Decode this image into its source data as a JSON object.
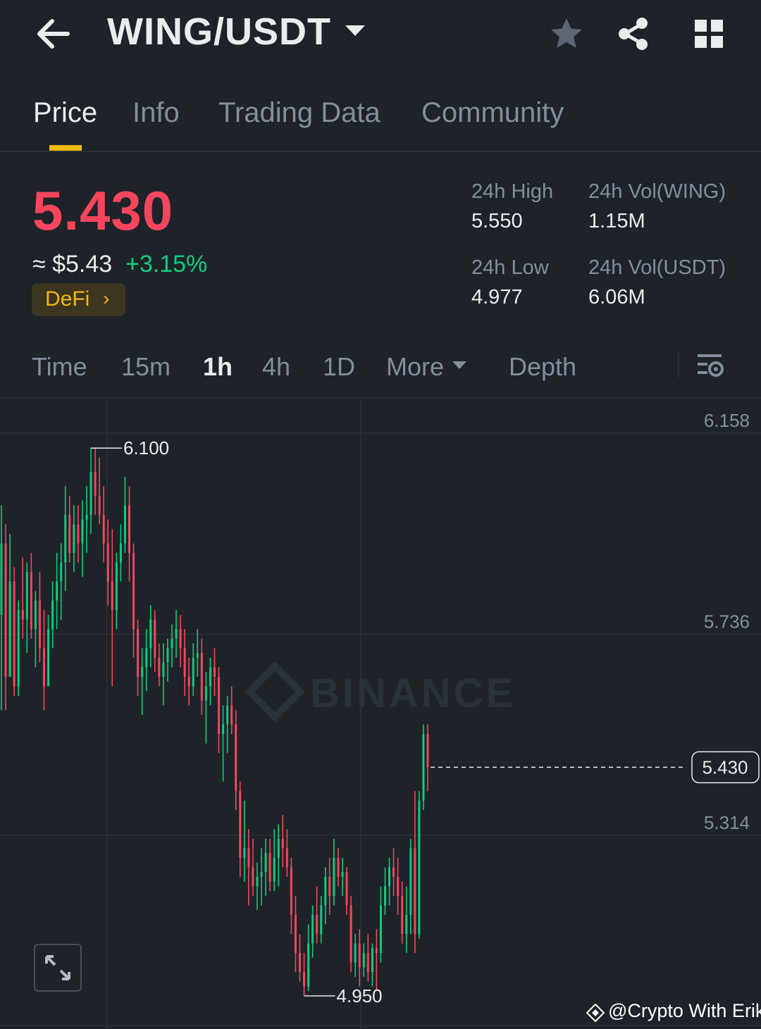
{
  "header": {
    "title": "WING/USDT",
    "back_icon": "arrow-left-icon",
    "dropdown_icon": "caret-down-icon",
    "actions": [
      "star-icon",
      "share-icon",
      "grid-icon"
    ]
  },
  "tabs": [
    {
      "label": "Price",
      "active": true
    },
    {
      "label": "Info",
      "active": false
    },
    {
      "label": "Trading Data",
      "active": false
    },
    {
      "label": "Community",
      "active": false
    }
  ],
  "ticker": {
    "last_price": "5.430",
    "usd_price": "≈ $5.43",
    "change_pct": "+3.15%",
    "tag": "DeFi",
    "tag_chevron": "›",
    "stats": {
      "high_label": "24h High",
      "high_value": "5.550",
      "low_label": "24h Low",
      "low_value": "4.977",
      "vol_base_label": "24h Vol(WING)",
      "vol_base_value": "1.15M",
      "vol_quote_label": "24h Vol(USDT)",
      "vol_quote_value": "6.06M"
    }
  },
  "intervals": {
    "items": [
      "Time",
      "15m",
      "1h",
      "4h",
      "1D"
    ],
    "active": "1h",
    "more": "More",
    "depth": "Depth",
    "settings_icon": "chart-settings-icon"
  },
  "chart_data": {
    "type": "candlestick",
    "interval": "1h",
    "y_axis_labels": [
      "6.158",
      "5.736",
      "5.314"
    ],
    "ylim": [
      4.95,
      6.158
    ],
    "max_marker": "6.100",
    "min_marker": "4.950",
    "last_price_label": "5.430",
    "last_price": 5.43,
    "watermark": "BINANCE",
    "colors": {
      "up": "#0ecb81",
      "down": "#f6465d",
      "grid": "#2b3139",
      "axis_text": "#848e9c"
    },
    "candles": [
      [
        5.75,
        5.98,
        5.55,
        5.9
      ],
      [
        5.9,
        5.94,
        5.55,
        5.62
      ],
      [
        5.62,
        5.92,
        5.65,
        5.82
      ],
      [
        5.82,
        5.85,
        5.58,
        5.6
      ],
      [
        5.6,
        5.78,
        5.58,
        5.76
      ],
      [
        5.76,
        5.87,
        5.7,
        5.74
      ],
      [
        5.74,
        5.86,
        5.67,
        5.84
      ],
      [
        5.84,
        5.88,
        5.7,
        5.72
      ],
      [
        5.72,
        5.8,
        5.64,
        5.78
      ],
      [
        5.78,
        5.84,
        5.65,
        5.68
      ],
      [
        5.68,
        5.76,
        5.55,
        5.6
      ],
      [
        5.6,
        5.75,
        5.66,
        5.72
      ],
      [
        5.72,
        5.82,
        5.68,
        5.78
      ],
      [
        5.78,
        5.88,
        5.72,
        5.82
      ],
      [
        5.82,
        5.9,
        5.74,
        5.86
      ],
      [
        5.86,
        6.02,
        5.8,
        5.96
      ],
      [
        5.96,
        6.0,
        5.86,
        5.88
      ],
      [
        5.88,
        5.98,
        5.84,
        5.94
      ],
      [
        5.94,
        5.98,
        5.86,
        5.9
      ],
      [
        5.9,
        5.99,
        5.83,
        5.95
      ],
      [
        5.95,
        6.02,
        5.88,
        5.96
      ],
      [
        5.96,
        6.1,
        5.92,
        6.05
      ],
      [
        6.05,
        6.1,
        5.96,
        6.0
      ],
      [
        6.0,
        6.08,
        5.94,
        5.96
      ],
      [
        5.96,
        6.02,
        5.86,
        5.9
      ],
      [
        5.9,
        5.95,
        5.77,
        5.82
      ],
      [
        5.82,
        5.93,
        5.6,
        5.76
      ],
      [
        5.76,
        5.88,
        5.72,
        5.86
      ],
      [
        5.86,
        5.94,
        5.82,
        5.9
      ],
      [
        5.9,
        6.04,
        5.88,
        5.98
      ],
      [
        5.98,
        6.02,
        5.82,
        5.88
      ],
      [
        5.88,
        5.9,
        5.66,
        5.72
      ],
      [
        5.72,
        5.74,
        5.58,
        5.62
      ],
      [
        5.62,
        5.68,
        5.54,
        5.64
      ],
      [
        5.64,
        5.72,
        5.59,
        5.68
      ],
      [
        5.68,
        5.77,
        5.64,
        5.74
      ],
      [
        5.74,
        5.76,
        5.63,
        5.66
      ],
      [
        5.66,
        5.69,
        5.6,
        5.62
      ],
      [
        5.62,
        5.69,
        5.56,
        5.65
      ],
      [
        5.65,
        5.7,
        5.61,
        5.68
      ],
      [
        5.68,
        5.73,
        5.64,
        5.7
      ],
      [
        5.7,
        5.76,
        5.66,
        5.72
      ],
      [
        5.72,
        5.75,
        5.64,
        5.68
      ],
      [
        5.68,
        5.72,
        5.58,
        5.62
      ],
      [
        5.62,
        5.66,
        5.56,
        5.6
      ],
      [
        5.6,
        5.69,
        5.58,
        5.66
      ],
      [
        5.66,
        5.72,
        5.62,
        5.67
      ],
      [
        5.67,
        5.7,
        5.54,
        5.57
      ],
      [
        5.57,
        5.63,
        5.48,
        5.6
      ],
      [
        5.6,
        5.66,
        5.56,
        5.64
      ],
      [
        5.64,
        5.68,
        5.58,
        5.62
      ],
      [
        5.62,
        5.64,
        5.46,
        5.5
      ],
      [
        5.5,
        5.56,
        5.4,
        5.52
      ],
      [
        5.52,
        5.58,
        5.46,
        5.56
      ],
      [
        5.56,
        5.6,
        5.5,
        5.52
      ],
      [
        5.52,
        5.55,
        5.34,
        5.38
      ],
      [
        5.38,
        5.4,
        5.2,
        5.24
      ],
      [
        5.24,
        5.36,
        5.19,
        5.26
      ],
      [
        5.26,
        5.3,
        5.14,
        5.22
      ],
      [
        5.22,
        5.28,
        5.16,
        5.18
      ],
      [
        5.18,
        5.23,
        5.13,
        5.2
      ],
      [
        5.2,
        5.26,
        5.14,
        5.21
      ],
      [
        5.21,
        5.28,
        5.16,
        5.25
      ],
      [
        5.25,
        5.28,
        5.17,
        5.19
      ],
      [
        5.19,
        5.3,
        5.17,
        5.24
      ],
      [
        5.24,
        5.31,
        5.18,
        5.28
      ],
      [
        5.28,
        5.33,
        5.22,
        5.26
      ],
      [
        5.26,
        5.3,
        5.2,
        5.22
      ],
      [
        5.22,
        5.24,
        5.08,
        5.12
      ],
      [
        5.12,
        5.16,
        5.0,
        5.04
      ],
      [
        5.04,
        5.08,
        4.98,
        5.0
      ],
      [
        5.0,
        5.04,
        4.95,
        4.97
      ],
      [
        4.97,
        5.1,
        4.96,
        5.06
      ],
      [
        5.06,
        5.14,
        5.03,
        5.12
      ],
      [
        5.12,
        5.18,
        5.06,
        5.08
      ],
      [
        5.08,
        5.16,
        5.06,
        5.14
      ],
      [
        5.14,
        5.22,
        5.1,
        5.2
      ],
      [
        5.2,
        5.24,
        5.12,
        5.16
      ],
      [
        5.16,
        5.28,
        5.14,
        5.24
      ],
      [
        5.24,
        5.26,
        5.18,
        5.2
      ],
      [
        5.2,
        5.24,
        5.16,
        5.21
      ],
      [
        5.21,
        5.22,
        5.12,
        5.14
      ],
      [
        5.14,
        5.16,
        5.0,
        5.02
      ],
      [
        5.02,
        5.08,
        4.99,
        5.06
      ],
      [
        5.06,
        5.09,
        4.97,
        5.01
      ],
      [
        5.01,
        5.06,
        4.99,
        5.04
      ],
      [
        5.04,
        5.08,
        4.98,
        5.0
      ],
      [
        5.0,
        5.06,
        4.97,
        5.05
      ],
      [
        5.05,
        5.09,
        4.96,
        5.04
      ],
      [
        5.04,
        5.18,
        5.02,
        5.14
      ],
      [
        5.14,
        5.22,
        5.12,
        5.18
      ],
      [
        5.18,
        5.24,
        5.14,
        5.22
      ],
      [
        5.22,
        5.26,
        5.16,
        5.2
      ],
      [
        5.2,
        5.24,
        5.12,
        5.16
      ],
      [
        5.16,
        5.19,
        5.06,
        5.08
      ],
      [
        5.08,
        5.18,
        5.04,
        5.12
      ],
      [
        5.12,
        5.28,
        5.08,
        5.26
      ],
      [
        5.26,
        5.38,
        5.04,
        5.08
      ],
      [
        5.08,
        5.38,
        5.07,
        5.36
      ],
      [
        5.36,
        5.52,
        5.34,
        5.5
      ],
      [
        5.5,
        5.52,
        5.38,
        5.43
      ]
    ]
  },
  "expand_icon": "expand-icon",
  "credit": "@Crypto With Erik"
}
